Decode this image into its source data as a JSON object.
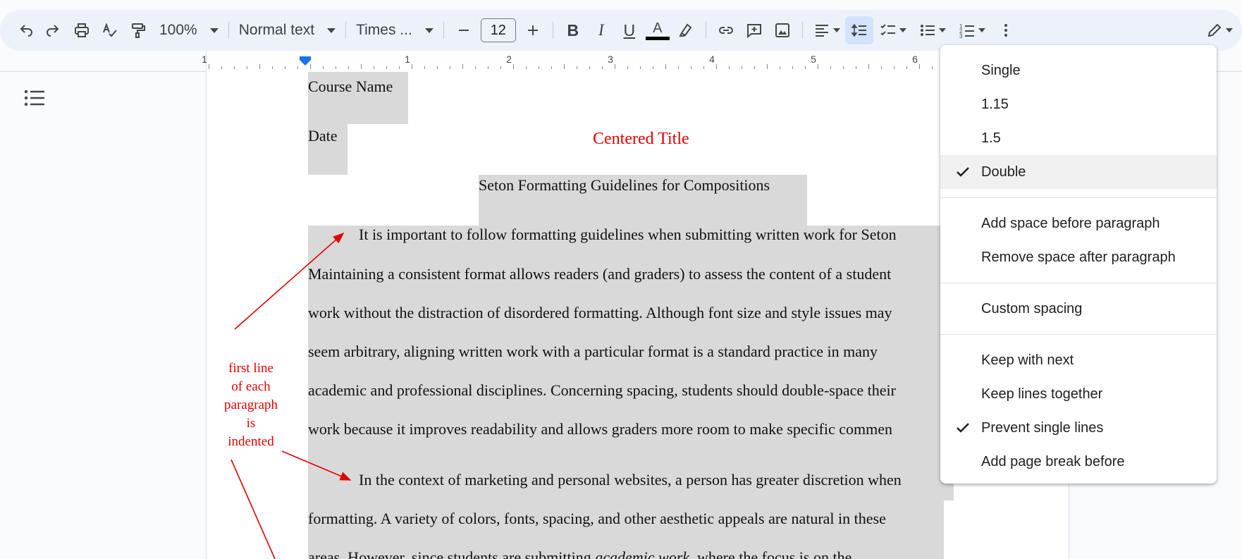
{
  "toolbar": {
    "zoom": "100%",
    "style": "Normal text",
    "font": "Times ...",
    "font_size": "12",
    "bold_letter": "B",
    "italic_letter": "I",
    "underline_letter": "U",
    "text_color_letter": "A",
    "text_color": "#000000"
  },
  "ruler": {
    "numbers": [
      "1",
      "1",
      "2",
      "3",
      "4",
      "5",
      "6"
    ]
  },
  "document": {
    "header_course": "Course Name",
    "header_date": "Date",
    "annotation_title": "Centered Title",
    "title": "Seton Formatting Guidelines for Compositions",
    "para1": [
      "It is important to follow formatting guidelines when submitting written work for Seton",
      "Maintaining a consistent format allows readers (and graders) to assess the content of a student",
      "work without the distraction of disordered formatting. Although font size and style issues may",
      "seem arbitrary, aligning written work with a particular format is a standard practice in many",
      "academic and professional disciplines. Concerning spacing, students should double-space their",
      "work because it improves readability and allows graders more room to make specific commen"
    ],
    "para2": [
      "In the context of marketing and personal websites, a person has greater discretion when",
      "formatting. A variety of colors, fonts, spacing, and other aesthetic appeals are natural in these",
      "areas. However, since students are submitting",
      "academic work",
      ", where the focus is on the"
    ],
    "annotation_note": [
      "first line",
      "of each",
      "paragraph",
      "is",
      "indented"
    ],
    "annotation_color": "#e50000"
  },
  "line_spacing_menu": {
    "items": [
      {
        "label": "Single",
        "checked": false
      },
      {
        "label": "1.15",
        "checked": false
      },
      {
        "label": "1.5",
        "checked": false
      },
      {
        "label": "Double",
        "checked": true
      }
    ],
    "paragraph_items": [
      "Add space before paragraph",
      "Remove space after paragraph"
    ],
    "custom": "Custom spacing",
    "keep_items": [
      {
        "label": "Keep with next",
        "checked": false
      },
      {
        "label": "Keep lines together",
        "checked": false
      },
      {
        "label": "Prevent single lines",
        "checked": true
      },
      {
        "label": "Add page break before",
        "checked": false
      }
    ]
  },
  "colors": {
    "toolbar_bg": "#edf2fa",
    "selection_bg": "#d9d9d9",
    "active_button": "#d3e3fd",
    "ruler_marker": "#1a73e8"
  }
}
